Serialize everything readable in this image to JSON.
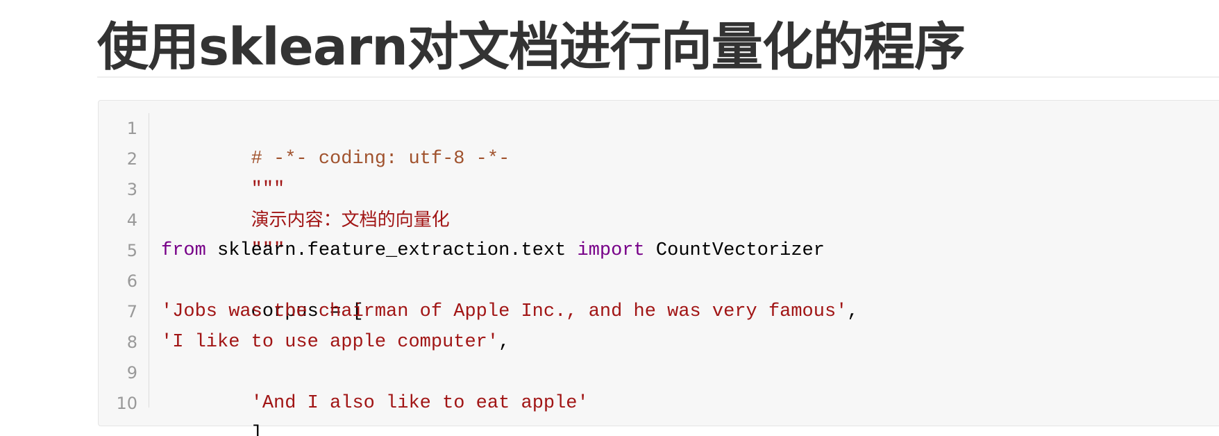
{
  "document": {
    "title": "使用sklearn对文档进行向量化的程序"
  },
  "code_block": {
    "line_numbers": [
      "1",
      "2",
      "3",
      "4",
      "5",
      "6",
      "7",
      "8",
      "9",
      "10"
    ],
    "lines": {
      "l1": {
        "comment": "# -*- coding: utf-8 -*-"
      },
      "l2": {
        "string": "\"\"\""
      },
      "l3": {
        "string": "演示内容：文档的向量化"
      },
      "l4": {
        "string": "\"\"\""
      },
      "l5": {
        "kw_from": "from",
        "module": " sklearn.feature_extraction.text ",
        "kw_import": "import",
        "name": " CountVectorizer"
      },
      "l6": {
        "text": "corpus = ["
      },
      "l7": {
        "string": "'Jobs was the chairman of Apple Inc., and he was very famous'",
        "punct": ","
      },
      "l8": {
        "string": "'I like to use apple computer'",
        "punct": ","
      },
      "l9": {
        "string": "'And I also like to eat apple'"
      },
      "l10": {
        "text": "]"
      }
    }
  },
  "colors": {
    "comment": "#a0522d",
    "string": "#a11515",
    "keyword": "#770088",
    "title": "#333333",
    "code_background": "#f7f7f7"
  }
}
